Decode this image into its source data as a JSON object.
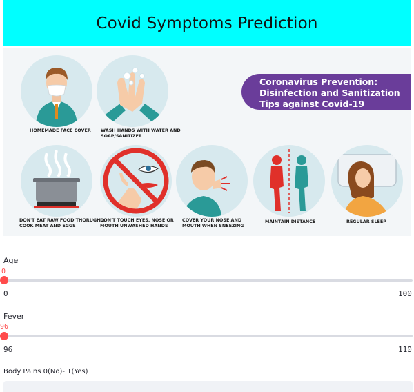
{
  "header": {
    "title": "Covid Symptoms Prediction",
    "bg_color": "#00ffff"
  },
  "banner": {
    "headline": [
      "Coronavirus Prevention:",
      "Disinfection and Sanitization",
      "Tips against Covid-19"
    ],
    "headline_color": "#6a3d9a",
    "tips": [
      {
        "icon": "face-mask-person-icon",
        "caption": [
          "HOMEMADE FACE COVER"
        ]
      },
      {
        "icon": "hand-washing-icon",
        "caption": [
          "WASH HANDS WITH WATER AND",
          "SOAP/SANITIZER"
        ]
      },
      {
        "icon": "cooking-pot-icon",
        "caption": [
          "DON'T EAT RAW FOOD THORUGHLY",
          "COOK MEAT AND EGGS"
        ]
      },
      {
        "icon": "no-touch-face-icon",
        "caption": [
          "DON'T TOUCH EYES, NOSE OR",
          "MOUTH UNWASHED HANDS"
        ]
      },
      {
        "icon": "sneeze-cover-icon",
        "caption": [
          "COVER YOUR NOSE AND",
          "MOUTH WHEN SNEEZING"
        ]
      },
      {
        "icon": "distance-icon",
        "caption": [
          "MAINTAIN DISTANCE"
        ]
      },
      {
        "icon": "sleep-icon",
        "caption": [
          "REGULAR SLEEP"
        ]
      }
    ]
  },
  "sliders": [
    {
      "label": "Age",
      "value": "0",
      "min": "0",
      "max": "100",
      "fraction": 0
    },
    {
      "label": "Fever",
      "value": "96",
      "min": "96",
      "max": "110",
      "fraction": 0
    }
  ],
  "body_pains": {
    "label": "Body Pains 0(No)- 1(Yes)"
  },
  "accent_color": "#ff4b4b"
}
